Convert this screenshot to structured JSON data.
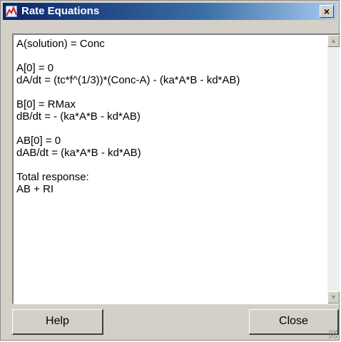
{
  "window": {
    "title": "Rate Equations",
    "close_glyph": "×",
    "icon": "app-icon",
    "title_bar_color": "#0a246a"
  },
  "text_area": {
    "content": "A(solution) = Conc\n\nA[0] = 0\ndA/dt = (tc*f^(1/3))*(Conc-A) - (ka*A*B - kd*AB)\n\nB[0] = RMax\ndB/dt = - (ka*A*B - kd*AB)\n\nAB[0] = 0\ndAB/dt = (ka*A*B - kd*AB)\n\nTotal response:\nAB + RI"
  },
  "scrollbar": {
    "up_icon": "arrow-up-icon",
    "down_icon": "arrow-down-icon"
  },
  "buttons": {
    "help_label": "Help",
    "close_label": "Close"
  }
}
